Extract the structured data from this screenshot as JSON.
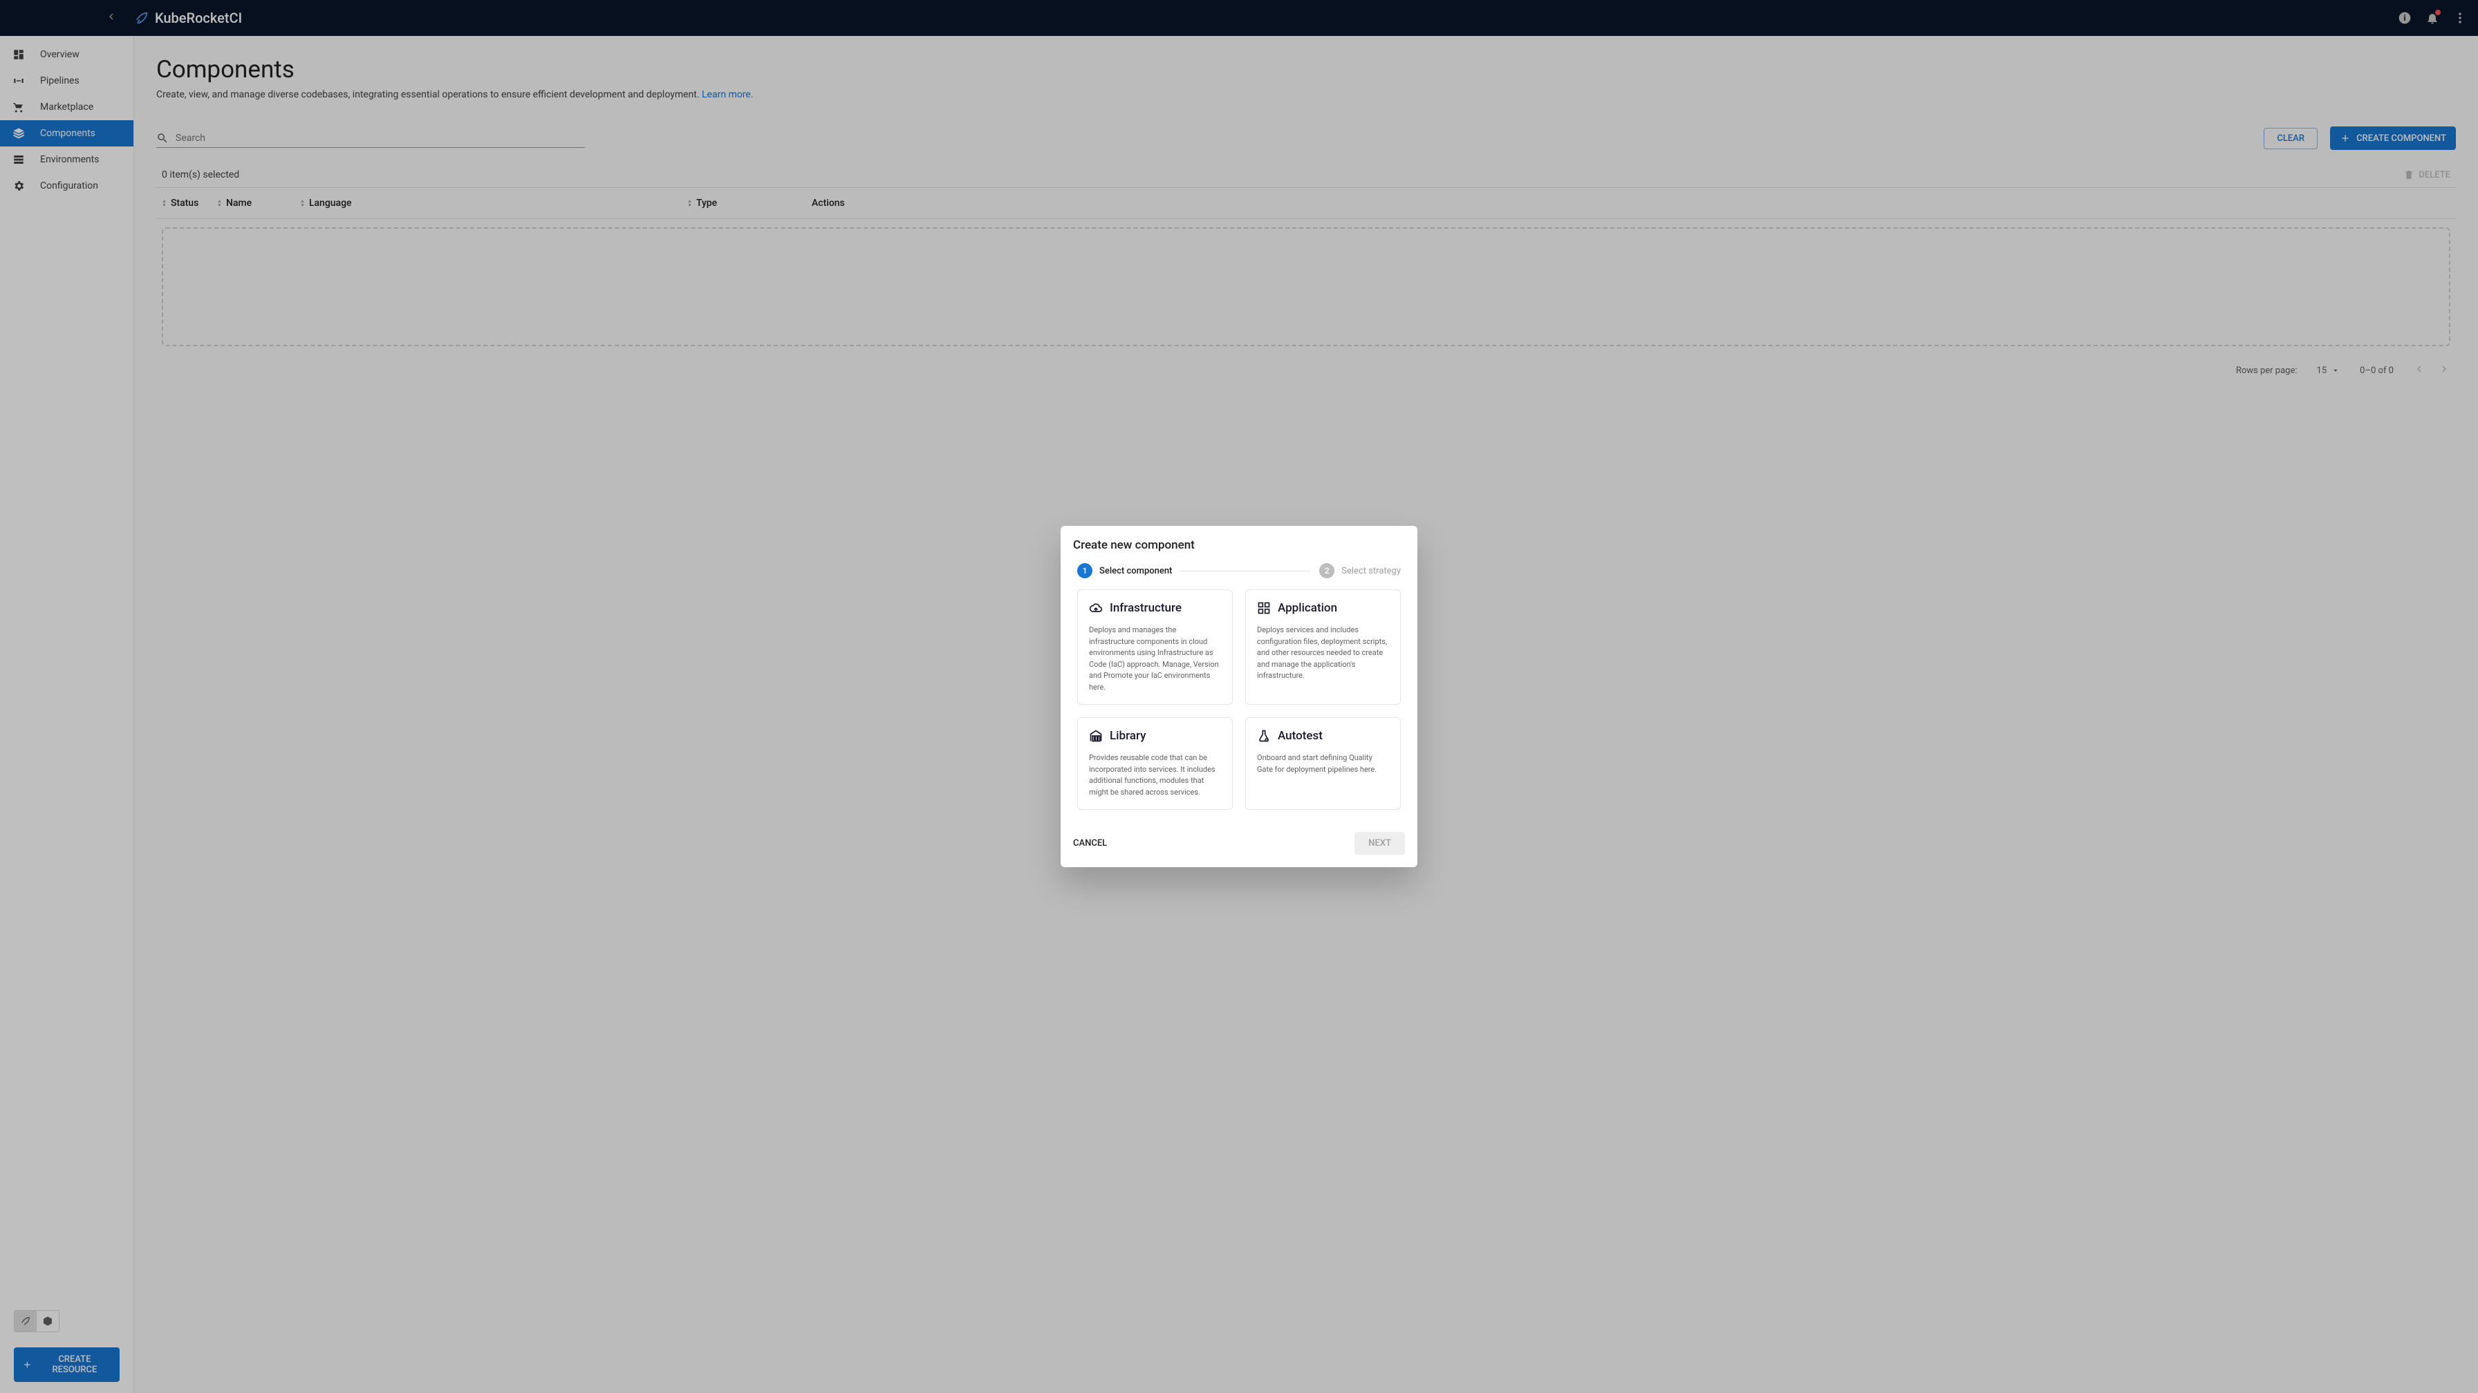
{
  "brand": {
    "name": "KubeRocketCI"
  },
  "header": {},
  "sidebar": {
    "items": [
      {
        "label": "Overview"
      },
      {
        "label": "Pipelines"
      },
      {
        "label": "Marketplace"
      },
      {
        "label": "Components"
      },
      {
        "label": "Environments"
      },
      {
        "label": "Configuration"
      }
    ],
    "create_resource": "CREATE RESOURCE"
  },
  "page": {
    "title": "Components",
    "subtitle_prefix": "Create, view, and manage diverse codebases, integrating essential operations to ensure efficient development and deployment. ",
    "learn_more": "Learn more."
  },
  "toolbar": {
    "search_placeholder": "Search",
    "clear": "CLEAR",
    "create_component": "CREATE COMPONENT"
  },
  "table": {
    "selected_text": "0 item(s) selected",
    "delete_label": "DELETE",
    "headers": {
      "status": "Status",
      "name": "Name",
      "language": "Language",
      "type": "Type",
      "actions": "Actions"
    }
  },
  "pagination": {
    "rows_label": "Rows per page:",
    "rows_value": "15",
    "range": "0–0 of 0"
  },
  "dialog": {
    "title": "Create new component",
    "steps": [
      {
        "num": "1",
        "label": "Select component"
      },
      {
        "num": "2",
        "label": "Select strategy"
      }
    ],
    "cards": {
      "infrastructure": {
        "title": "Infrastructure",
        "desc": "Deploys and manages the infrastructure components in cloud environments using Infrastructure as Code (IaC) approach. Manage, Version and Promote your IaC environments here."
      },
      "application": {
        "title": "Application",
        "desc": "Deploys services and includes configuration files, deployment scripts, and other resources needed to create and manage the application's infrastructure."
      },
      "library": {
        "title": "Library",
        "desc": "Provides reusable code that can be incorporated into services. It includes additional functions, modules that might be shared across services."
      },
      "autotest": {
        "title": "Autotest",
        "desc": "Onboard and start defining Quality Gate for deployment pipelines here."
      }
    },
    "cancel": "CANCEL",
    "next": "NEXT"
  }
}
